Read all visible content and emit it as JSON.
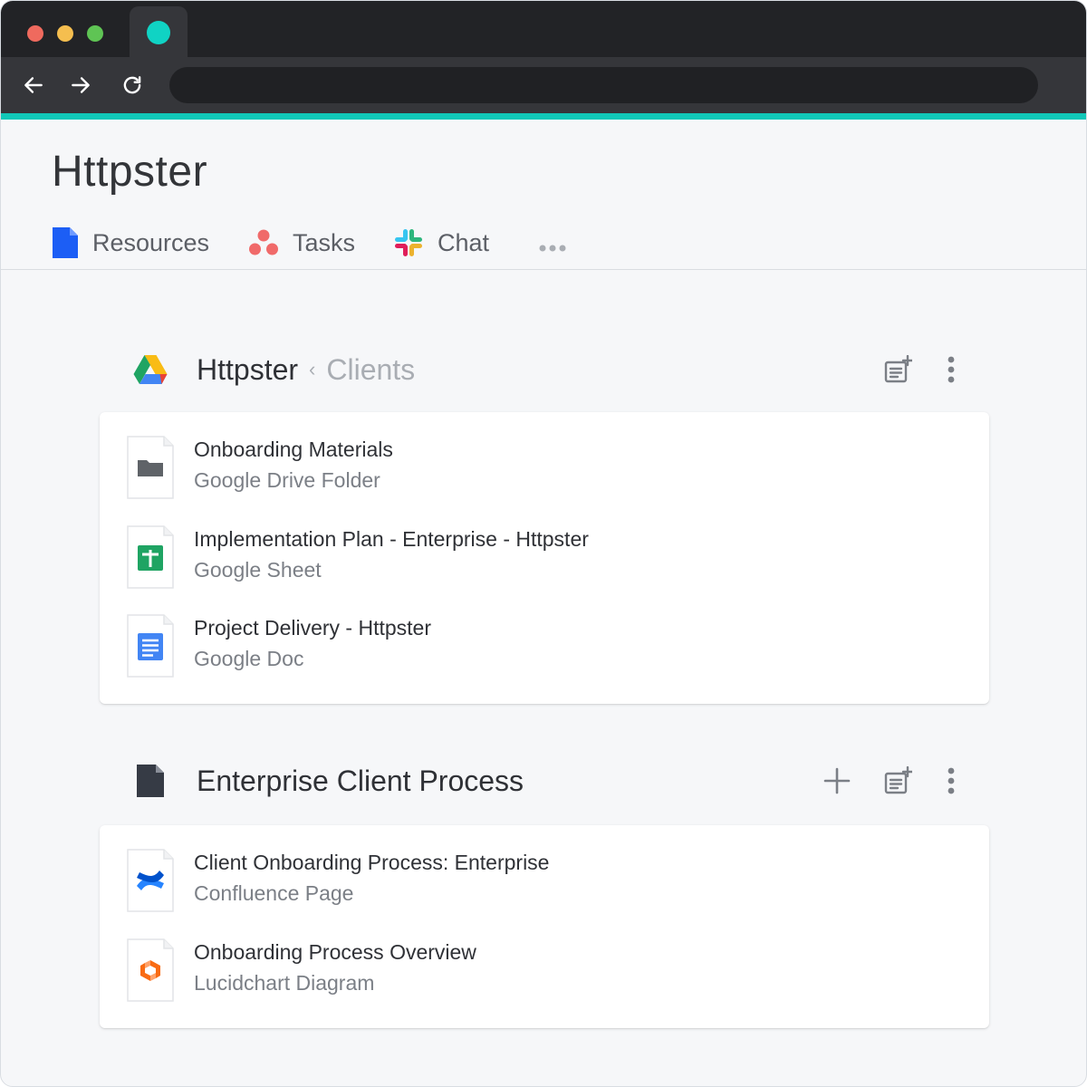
{
  "app": {
    "title": "Httpster",
    "tabs": [
      {
        "label": "Resources",
        "icon": "document-icon"
      },
      {
        "label": "Tasks",
        "icon": "asana-icon"
      },
      {
        "label": "Chat",
        "icon": "slack-icon"
      }
    ],
    "more_icon": "more-horizontal-icon"
  },
  "colors": {
    "accent": "#10c8b8",
    "chrome_dark": "#222326",
    "chrome_toolbar": "#35363a"
  },
  "sections": [
    {
      "breadcrumb_root": "Httpster",
      "breadcrumb_separator": "‹",
      "breadcrumb_current": "Clients",
      "icon": "google-drive-icon",
      "items": [
        {
          "name": "Onboarding Materials",
          "type": "Google Drive Folder",
          "icon": "folder-icon"
        },
        {
          "name": "Implementation Plan - Enterprise - Httpster",
          "type": "Google Sheet",
          "icon": "google-sheets-icon"
        },
        {
          "name": "Project Delivery - Httpster",
          "type": "Google Doc",
          "icon": "google-docs-icon"
        }
      ]
    },
    {
      "title": "Enterprise Client Process",
      "icon": "document-icon",
      "items": [
        {
          "name": "Client Onboarding Process: Enterprise",
          "type": "Confluence Page",
          "icon": "confluence-icon"
        },
        {
          "name": "Onboarding Process Overview",
          "type": "Lucidchart Diagram",
          "icon": "lucidchart-icon"
        }
      ]
    }
  ]
}
